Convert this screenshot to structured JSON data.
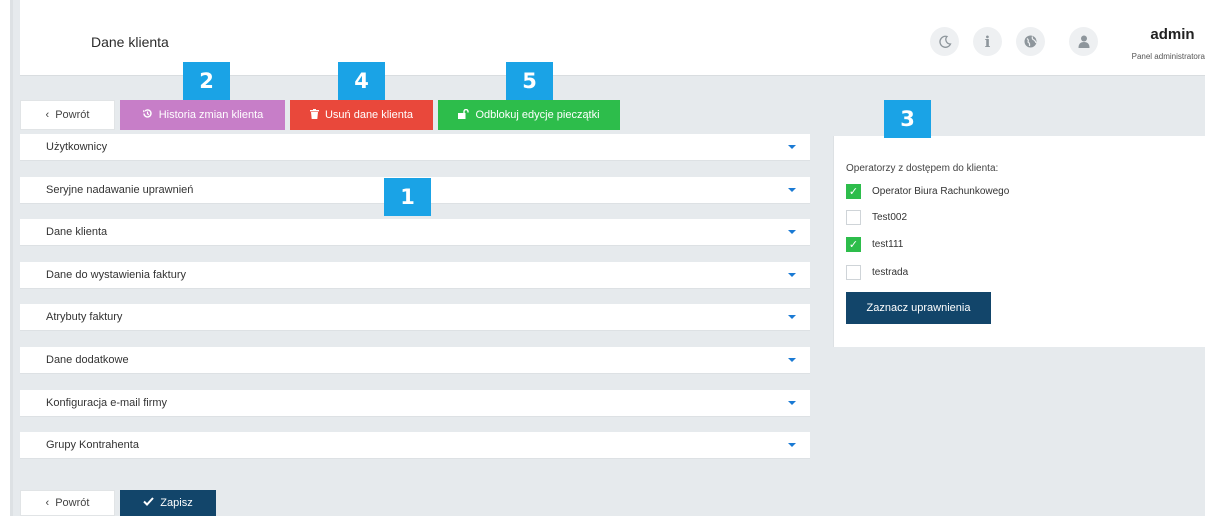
{
  "header": {
    "title": "Dane klienta",
    "icons": [
      "moon-icon",
      "info-icon",
      "globe-icon",
      "user-icon"
    ],
    "user_name": "admin",
    "user_role": "Panel administratora"
  },
  "toolbar": {
    "back_label": "Powrót",
    "history_label": "Historia zmian klienta",
    "delete_label": "Usuń dane klienta",
    "unlock_label": "Odblokuj edycje pieczątki"
  },
  "badges": [
    "1",
    "2",
    "3",
    "4",
    "5"
  ],
  "sections": [
    "Użytkownicy",
    "Seryjne nadawanie uprawnień",
    "Dane klienta",
    "Dane do wystawienia faktury",
    "Atrybuty faktury",
    "Dane dodatkowe",
    "Konfiguracja e-mail firmy",
    "Grupy Kontrahenta"
  ],
  "operators_panel": {
    "title": "Operatorzy z dostępem do klienta:",
    "operators": [
      {
        "label": "Operator Biura Rachunkowego",
        "checked": true
      },
      {
        "label": "Test002",
        "checked": false
      },
      {
        "label": "test111",
        "checked": true
      },
      {
        "label": "testrada",
        "checked": false
      }
    ],
    "mark_button": "Zaznacz uprawnienia"
  },
  "footer": {
    "back_label": "Powrót",
    "save_label": "Zapisz"
  },
  "colors": {
    "history": "#c77ec8",
    "delete": "#e9483b",
    "unlock": "#2dbd4b",
    "primary": "#12456a",
    "badge": "#1aa3e6",
    "check": "#2dbd4b"
  }
}
